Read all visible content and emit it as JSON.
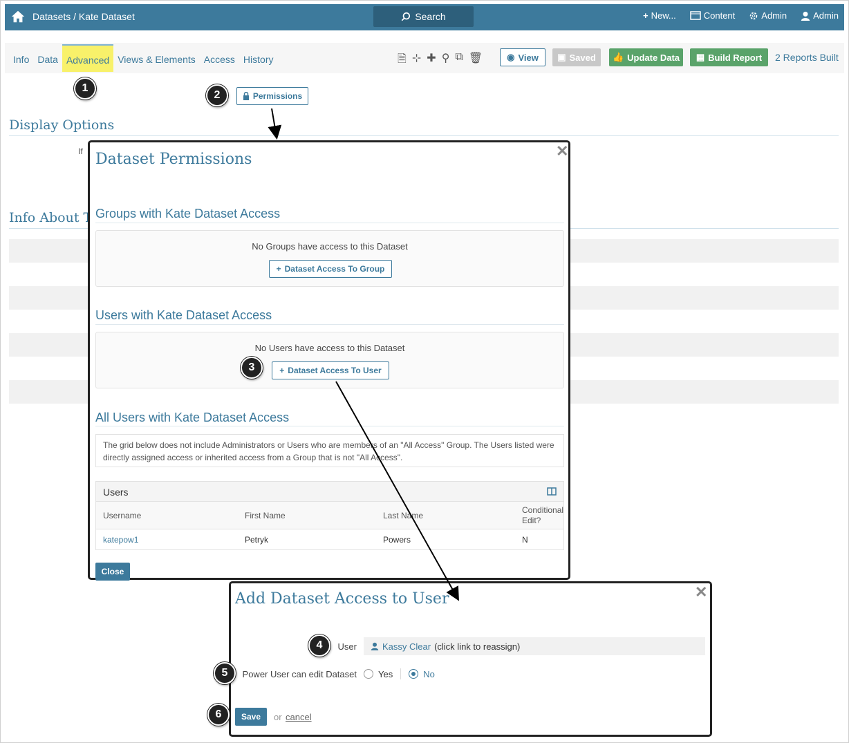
{
  "topbar": {
    "breadcrumb": "Datasets / Kate Dataset",
    "search_label": "Search",
    "new_label": "New...",
    "content_label": "Content",
    "admin_label": "Admin",
    "user_label": "Admin"
  },
  "tabs": [
    "Info",
    "Data",
    "Advanced",
    "Views & Elements",
    "Access",
    "History"
  ],
  "active_tab": "Advanced",
  "toolbar": {
    "view_label": "View",
    "saved_label": "Saved",
    "update_label": "Update Data",
    "build_label": "Build Report",
    "reports_built": "2 Reports Built"
  },
  "page": {
    "permissions_label": "Permissions",
    "display_options": "Display Options",
    "info_about": "Info About Th",
    "snippet": "If"
  },
  "steps": [
    "1",
    "2",
    "3",
    "4",
    "5",
    "6"
  ],
  "permissions_modal": {
    "title": "Dataset Permissions",
    "groups_heading": "Groups with Kate Dataset Access",
    "groups_empty": "No Groups have access to this Dataset",
    "groups_button": "Dataset Access To Group",
    "users_heading": "Users with Kate Dataset Access",
    "users_empty": "No Users have access to this Dataset",
    "users_button": "Dataset Access To User",
    "all_users_heading": "All Users with Kate Dataset Access",
    "note": "The grid below does not include Administrators or Users who are members of an \"All Access\" Group. The Users listed were directly assigned access or inherited access from a Group that is not \"All Access\".",
    "grid_title": "Users",
    "columns": [
      "Username",
      "First Name",
      "Last Name",
      "Conditional Edit?"
    ],
    "rows": [
      [
        "katepow1",
        "Petryk",
        "Powers",
        "N"
      ]
    ],
    "close_label": "Close"
  },
  "add_user_modal": {
    "title": "Add Dataset Access to User",
    "user_label": "User",
    "user_link": "Kassy Clear",
    "user_hint": "(click link to reassign)",
    "power_label": "Power User can edit Dataset",
    "yes_label": "Yes",
    "no_label": "No",
    "selected": "No",
    "save_label": "Save",
    "or_label": "or",
    "cancel_label": "cancel"
  },
  "colors": {
    "accent": "#3d7a9c",
    "success": "#5aa36a",
    "highlight": "#f8f16a"
  }
}
